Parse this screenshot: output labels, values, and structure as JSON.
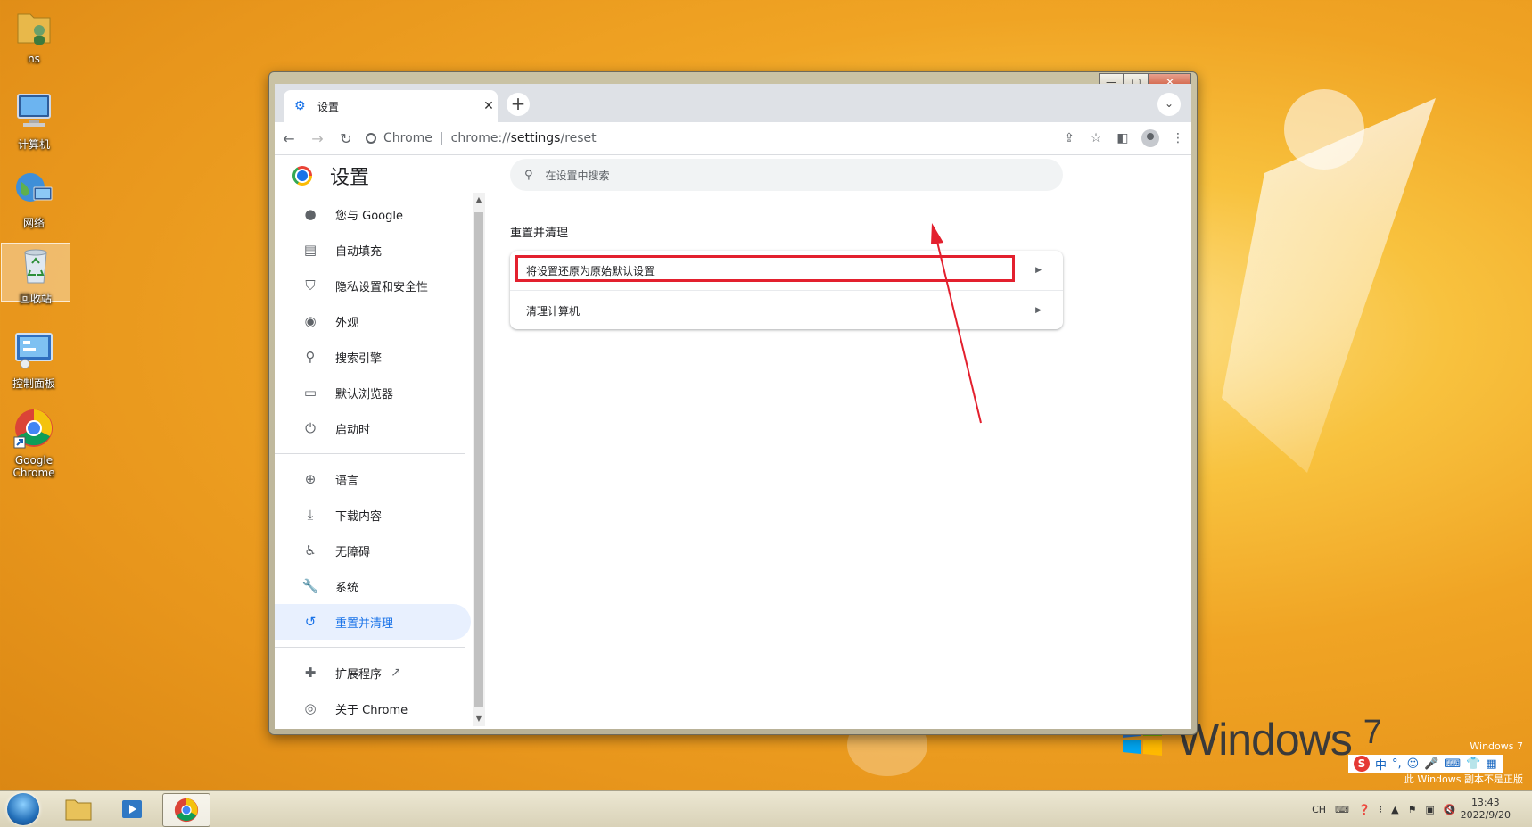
{
  "desktop": {
    "icons": [
      {
        "label": "ns"
      },
      {
        "label": "计算机"
      },
      {
        "label": "网络"
      },
      {
        "label": "回收站"
      },
      {
        "label": "控制面板"
      },
      {
        "label": "Google Chrome"
      }
    ],
    "watermark_line1": "Windows 7",
    "watermark_line2": "此 Windows 副本不是正版",
    "logo_text": "Windows",
    "logo_version": "7"
  },
  "window_controls": {
    "minimize": "—",
    "maximize": "▢",
    "close": "✕"
  },
  "browser": {
    "tab_title": "设置",
    "omnibox_chip": "Chrome",
    "url_prefix": "chrome://",
    "url_path": "settings",
    "url_suffix": "/reset"
  },
  "settings": {
    "title": "设置",
    "search_placeholder": "在设置中搜索",
    "nav": [
      {
        "label": "您与 Google",
        "icon": "person-icon"
      },
      {
        "label": "自动填充",
        "icon": "clipboard-icon"
      },
      {
        "label": "隐私设置和安全性",
        "icon": "shield-icon"
      },
      {
        "label": "外观",
        "icon": "palette-icon"
      },
      {
        "label": "搜索引擎",
        "icon": "search-icon"
      },
      {
        "label": "默认浏览器",
        "icon": "browser-icon"
      },
      {
        "label": "启动时",
        "icon": "power-icon"
      },
      {
        "label": "语言",
        "icon": "globe-icon"
      },
      {
        "label": "下载内容",
        "icon": "download-icon"
      },
      {
        "label": "无障碍",
        "icon": "accessibility-icon"
      },
      {
        "label": "系统",
        "icon": "wrench-icon"
      },
      {
        "label": "重置并清理",
        "icon": "restore-icon",
        "active": true
      },
      {
        "label": "扩展程序",
        "icon": "puzzle-icon"
      },
      {
        "label": "关于 Chrome",
        "icon": "chrome-icon"
      }
    ],
    "section_title": "重置并清理",
    "rows": [
      {
        "label": "将设置还原为原始默认设置"
      },
      {
        "label": "清理计算机"
      }
    ]
  },
  "tray": {
    "lang": "CH",
    "time": "13:43",
    "date": "2022/9/20"
  },
  "ime": {
    "mode": "中"
  },
  "colors": {
    "accent": "#1a73e8",
    "highlight": "#e3202e"
  }
}
